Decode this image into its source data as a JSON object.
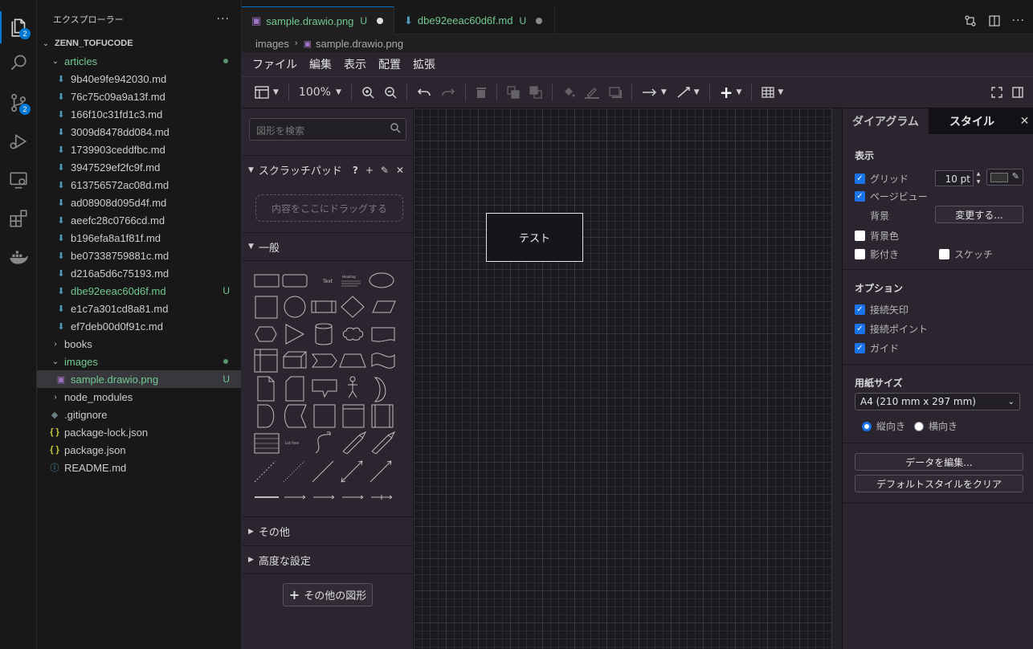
{
  "activity_bar": {
    "explorer_badge": "2",
    "scm_badge": "2"
  },
  "explorer": {
    "title": "エクスプローラー",
    "root": "ZENN_TOFUCODE",
    "items": [
      {
        "label": "articles",
        "kind": "folder-open",
        "status": "dot"
      },
      {
        "label": "9b40e9fe942030.md",
        "kind": "md"
      },
      {
        "label": "76c75c09a9a13f.md",
        "kind": "md"
      },
      {
        "label": "166f10c31fd1c3.md",
        "kind": "md"
      },
      {
        "label": "3009d8478dd084.md",
        "kind": "md"
      },
      {
        "label": "1739903ceddfbc.md",
        "kind": "md"
      },
      {
        "label": "3947529ef2fc9f.md",
        "kind": "md"
      },
      {
        "label": "613756572ac08d.md",
        "kind": "md"
      },
      {
        "label": "ad08908d095d4f.md",
        "kind": "md"
      },
      {
        "label": "aeefc28c0766cd.md",
        "kind": "md"
      },
      {
        "label": "b196efa8a1f81f.md",
        "kind": "md"
      },
      {
        "label": "be07338759881c.md",
        "kind": "md"
      },
      {
        "label": "d216a5d6c75193.md",
        "kind": "md"
      },
      {
        "label": "dbe92eeac60d6f.md",
        "kind": "md",
        "status": "U"
      },
      {
        "label": "e1c7a301cd8a81.md",
        "kind": "md"
      },
      {
        "label": "ef7deb00d0f91c.md",
        "kind": "md"
      },
      {
        "label": "books",
        "kind": "folder"
      },
      {
        "label": "images",
        "kind": "folder-open",
        "status": "dot"
      },
      {
        "label": "sample.drawio.png",
        "kind": "png",
        "status": "U"
      },
      {
        "label": "node_modules",
        "kind": "folder"
      },
      {
        "label": ".gitignore",
        "kind": "git"
      },
      {
        "label": "package-lock.json",
        "kind": "json"
      },
      {
        "label": "package.json",
        "kind": "json"
      },
      {
        "label": "README.md",
        "kind": "info"
      }
    ]
  },
  "tabs": [
    {
      "label": "sample.drawio.png",
      "status": "U"
    },
    {
      "label": "dbe92eeac60d6f.md",
      "status": "U"
    }
  ],
  "breadcrumb": [
    "images",
    "sample.drawio.png"
  ],
  "drawio": {
    "menu": [
      "ファイル",
      "編集",
      "表示",
      "配置",
      "拡張"
    ],
    "zoom": "100%",
    "search_placeholder": "図形を検索",
    "scratchpad": {
      "title": "スクラッチパッド",
      "help": "?",
      "dropzone": "内容をここにドラッグする"
    },
    "general_section": "一般",
    "other_section": "その他",
    "advanced_section": "高度な設定",
    "more_shapes_button": "その他の図形",
    "shape_text_label": "Text",
    "shape_heading_label": "Heading",
    "shape_list_label": "List Item",
    "canvas_node_text": "テスト",
    "format_panel": {
      "tab_diagram": "ダイアグラム",
      "tab_style": "スタイル",
      "view_section": "表示",
      "grid_label": "グリッド",
      "grid_size": "10 pt",
      "page_view_label": "ページビュー",
      "background_label": "背景",
      "change_button": "変更する...",
      "bg_color_label": "背景色",
      "shadow_label": "影付き",
      "sketch_label": "スケッチ",
      "options_section": "オプション",
      "connection_arrows": "接続矢印",
      "connection_points": "接続ポイント",
      "guides": "ガイド",
      "paper_size_section": "用紙サイズ",
      "paper_size_value": "A4 (210 mm x 297 mm)",
      "portrait": "縦向き",
      "landscape": "横向き",
      "edit_data_button": "データを編集...",
      "clear_default_style_button": "デフォルトスタイルをクリア"
    }
  },
  "colors": {
    "accent": "#0078d4",
    "git_untracked": "#73c991",
    "drawio_panel": "#2a252f",
    "checkbox": "#1a73e8"
  }
}
